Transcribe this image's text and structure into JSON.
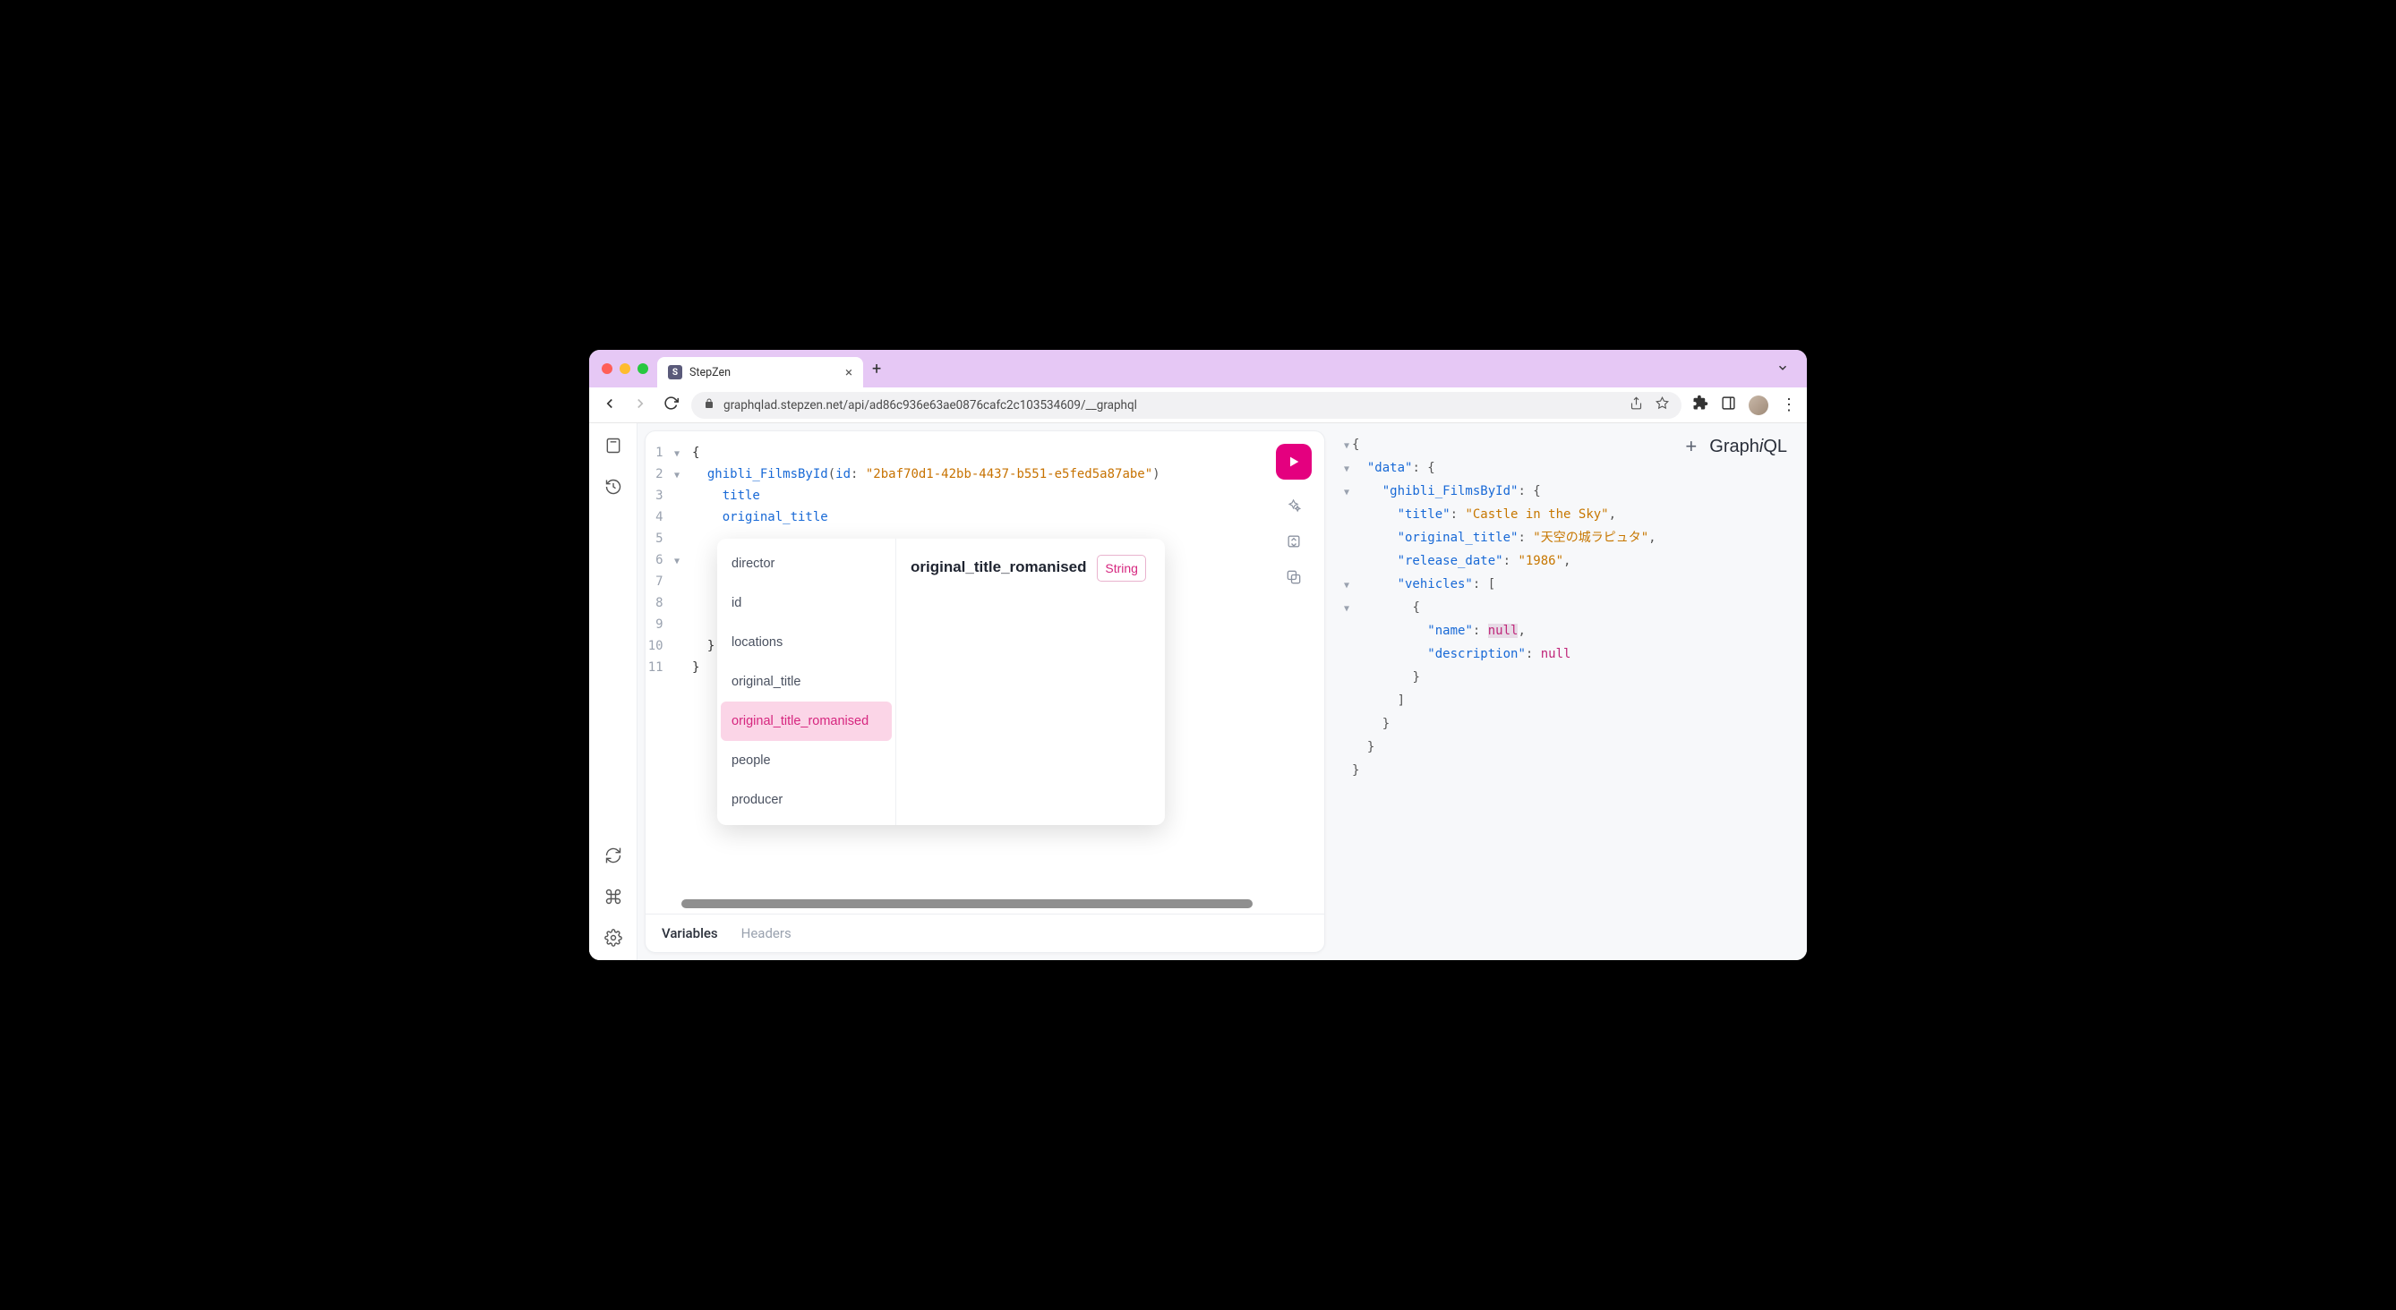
{
  "browser": {
    "tab_title": "StepZen",
    "url": "graphqlad.stepzen.net/api/ad86c936e63ae0876cafc2c103534609/__graphql"
  },
  "app": {
    "logo": "GraphiQL"
  },
  "editor": {
    "lines": [
      "1",
      "2",
      "3",
      "4",
      "5",
      "6",
      "7",
      "8",
      "9",
      "10",
      "11"
    ],
    "query_field": "ghibli_FilmsById",
    "arg_name": "id",
    "arg_value": "\"2baf70d1-42bb-4437-b551-e5fed5a87abe\"",
    "field_title": "title",
    "field_orig": "original_title"
  },
  "autocomplete": {
    "items": [
      "director",
      "id",
      "locations",
      "original_title",
      "original_title_romanised",
      "people",
      "producer"
    ],
    "selected": "original_title_romanised",
    "detail_title": "original_title_romanised",
    "detail_type": "String"
  },
  "bottom_tabs": {
    "variables": "Variables",
    "headers": "Headers"
  },
  "response": {
    "data_key": "\"data\"",
    "root_key": "\"ghibli_FilmsById\"",
    "title_key": "\"title\"",
    "title_val": "\"Castle in the Sky\"",
    "orig_key": "\"original_title\"",
    "orig_val": "\"天空の城ラピュタ\"",
    "rel_key": "\"release_date\"",
    "rel_val": "\"1986\"",
    "veh_key": "\"vehicles\"",
    "name_key": "\"name\"",
    "name_val": "null",
    "desc_key": "\"description\"",
    "desc_val": "null"
  }
}
